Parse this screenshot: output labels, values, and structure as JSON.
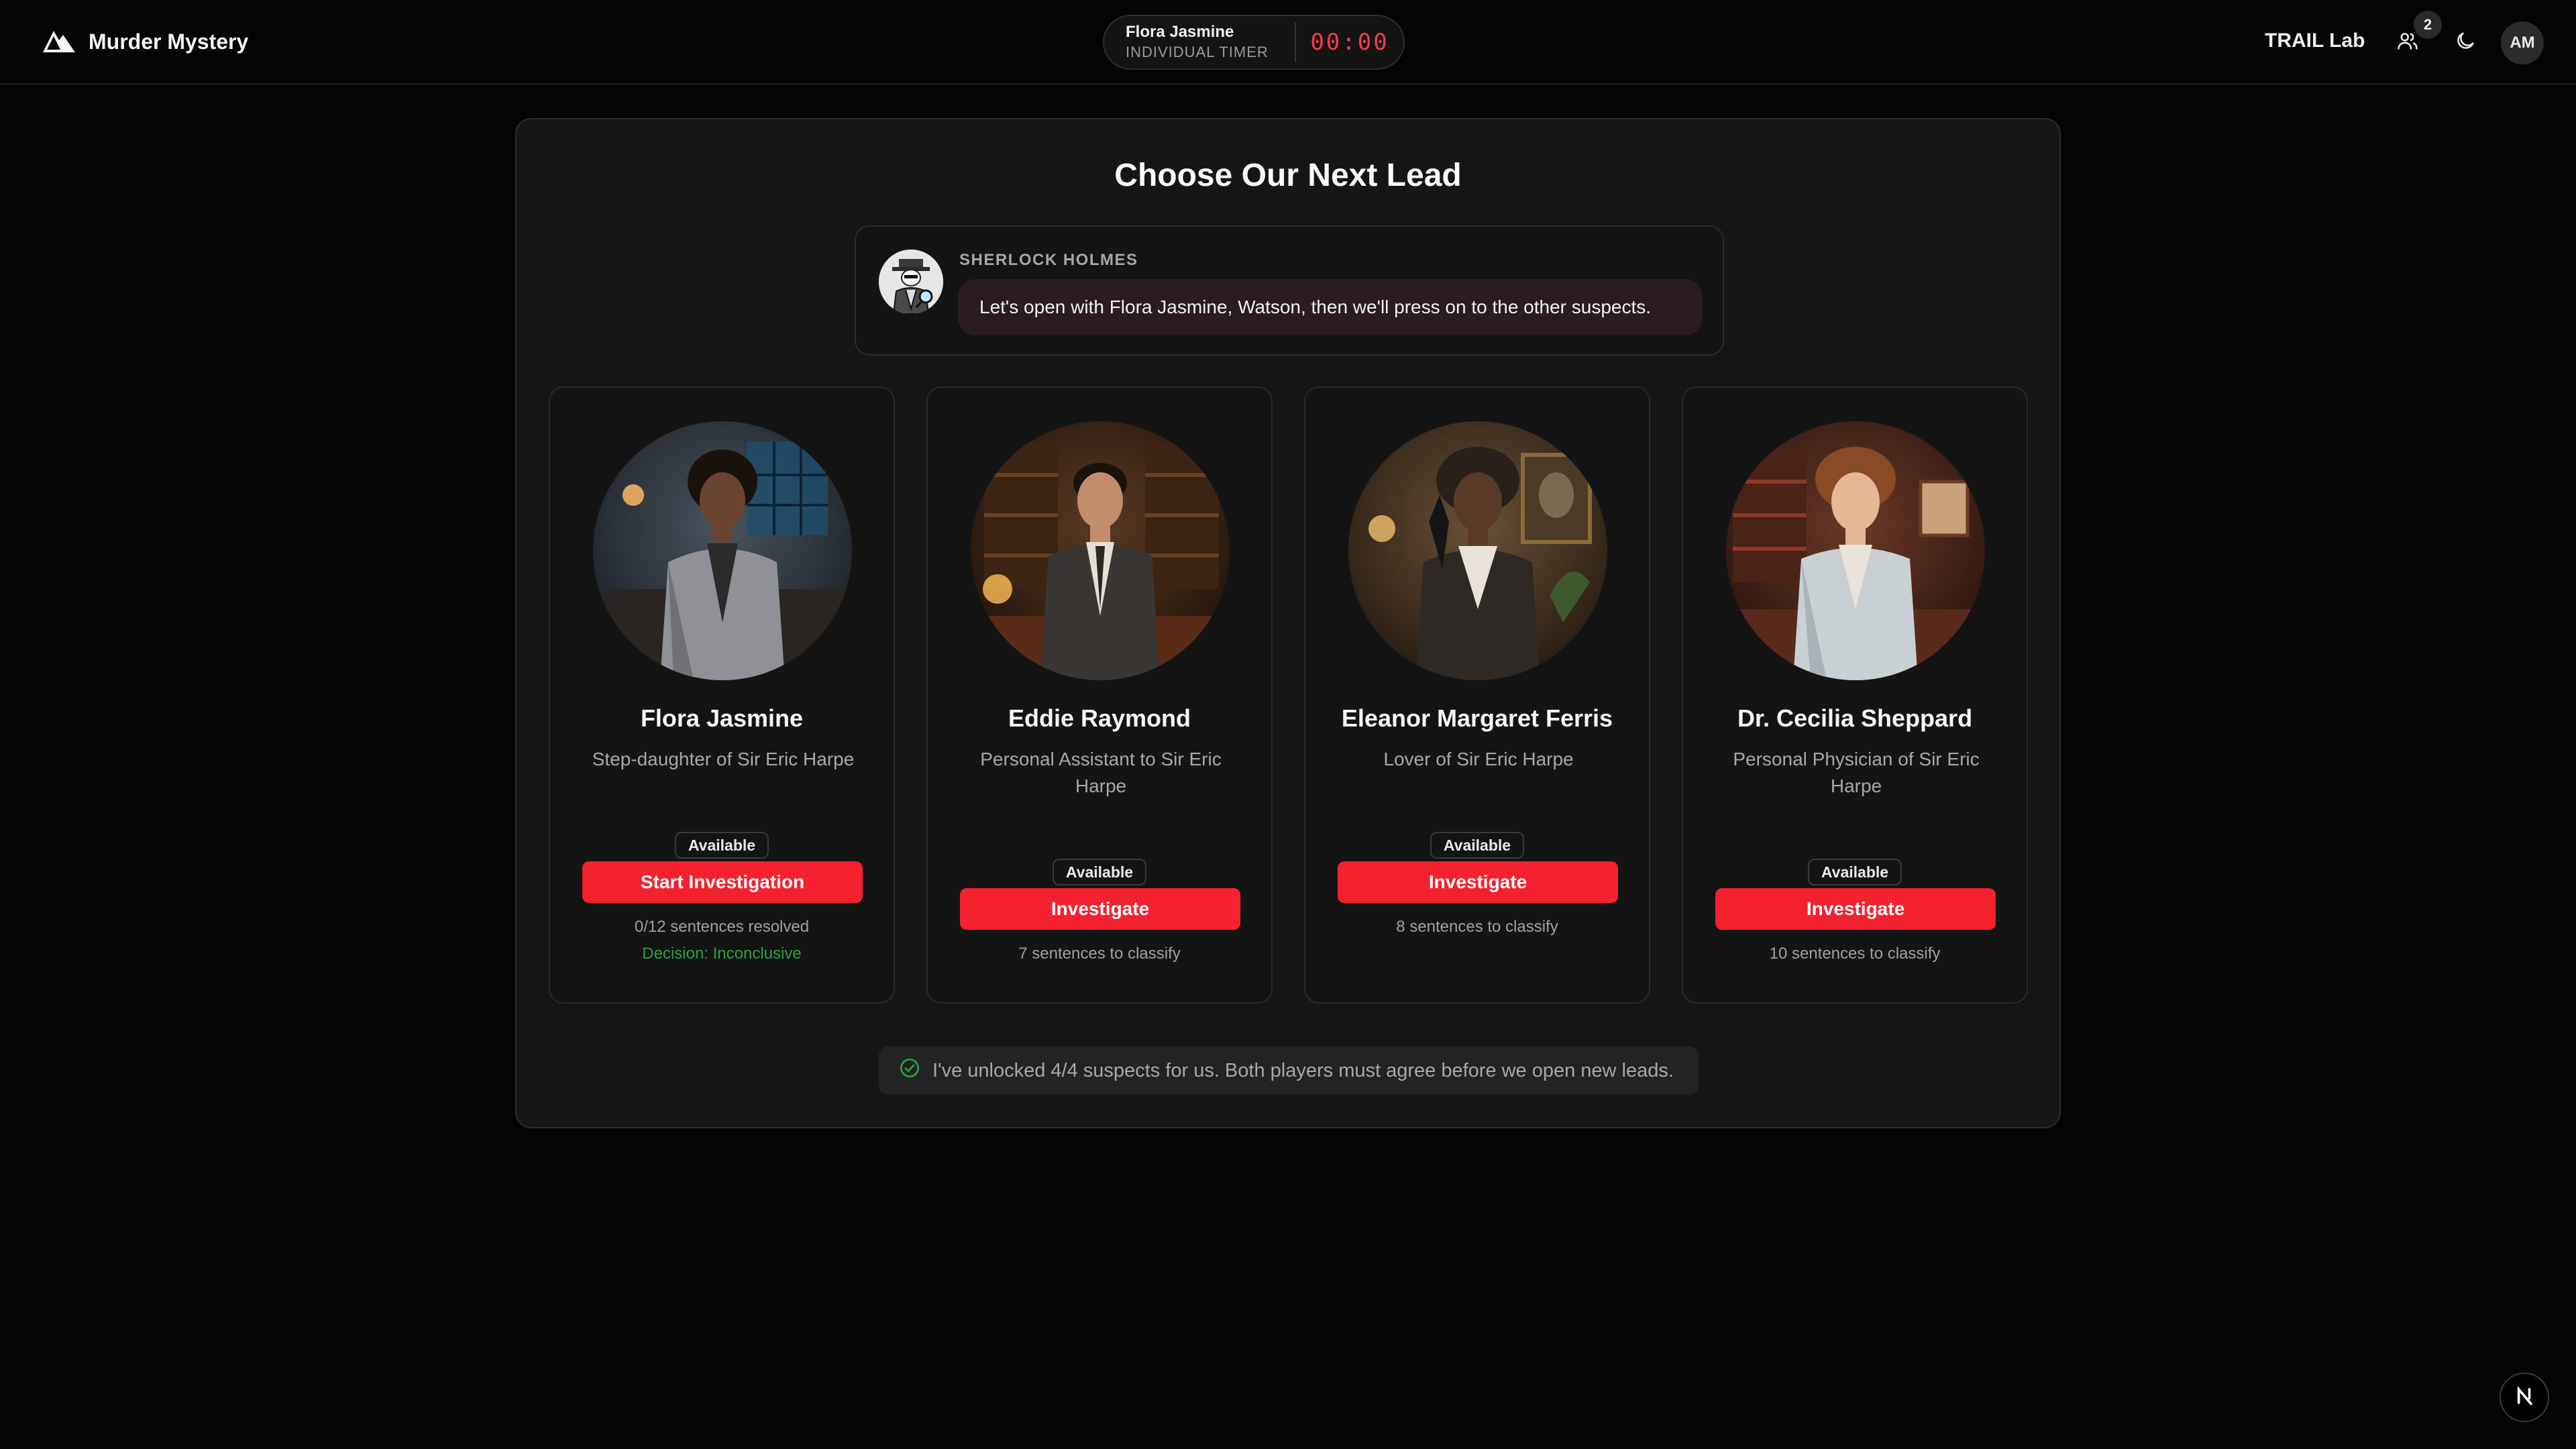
{
  "app": {
    "title": "Murder Mystery"
  },
  "timer": {
    "name": "Flora Jasmine",
    "label": "INDIVIDUAL TIMER",
    "time": "00:00"
  },
  "header": {
    "lab": "TRAIL Lab",
    "users_count": "2",
    "avatar_initials": "AM"
  },
  "page": {
    "title": "Choose Our Next Lead"
  },
  "holmes": {
    "name": "SHERLOCK HOLMES",
    "message": "Let's open with Flora Jasmine, Watson, then we'll press on to the other suspects."
  },
  "suspects": [
    {
      "name": "Flora Jasmine",
      "role": "Step-daughter of Sir Eric Harpe",
      "status": "Available",
      "action": "Start Investigation",
      "note": "0/12 sentences resolved",
      "decision": "Decision: Inconclusive"
    },
    {
      "name": "Eddie Raymond",
      "role": "Personal Assistant to Sir Eric Harpe",
      "status": "Available",
      "action": "Investigate",
      "note": "7 sentences to classify"
    },
    {
      "name": "Eleanor Margaret Ferris",
      "role": "Lover of Sir Eric Harpe",
      "status": "Available",
      "action": "Investigate",
      "note": "8 sentences to classify"
    },
    {
      "name": "Dr. Cecilia Sheppard",
      "role": "Personal Physician of Sir Eric Harpe",
      "status": "Available",
      "action": "Investigate",
      "note": "10 sentences to classify"
    }
  ],
  "footer": {
    "unlock_message": "I've unlocked 4/4 suspects for us. Both players must agree before we open new leads."
  },
  "icons": {
    "brand": "mountain-logo-icon",
    "users": "users-icon",
    "theme": "moon-icon",
    "check": "check-circle-icon",
    "next": "nextjs-logo-icon"
  },
  "colors": {
    "background": "#050505",
    "panel": "#161617",
    "accent_red": "#f4212f",
    "timer_red": "#ff3b46",
    "success_green": "#2ea043",
    "bubble": "#2a1c20"
  }
}
